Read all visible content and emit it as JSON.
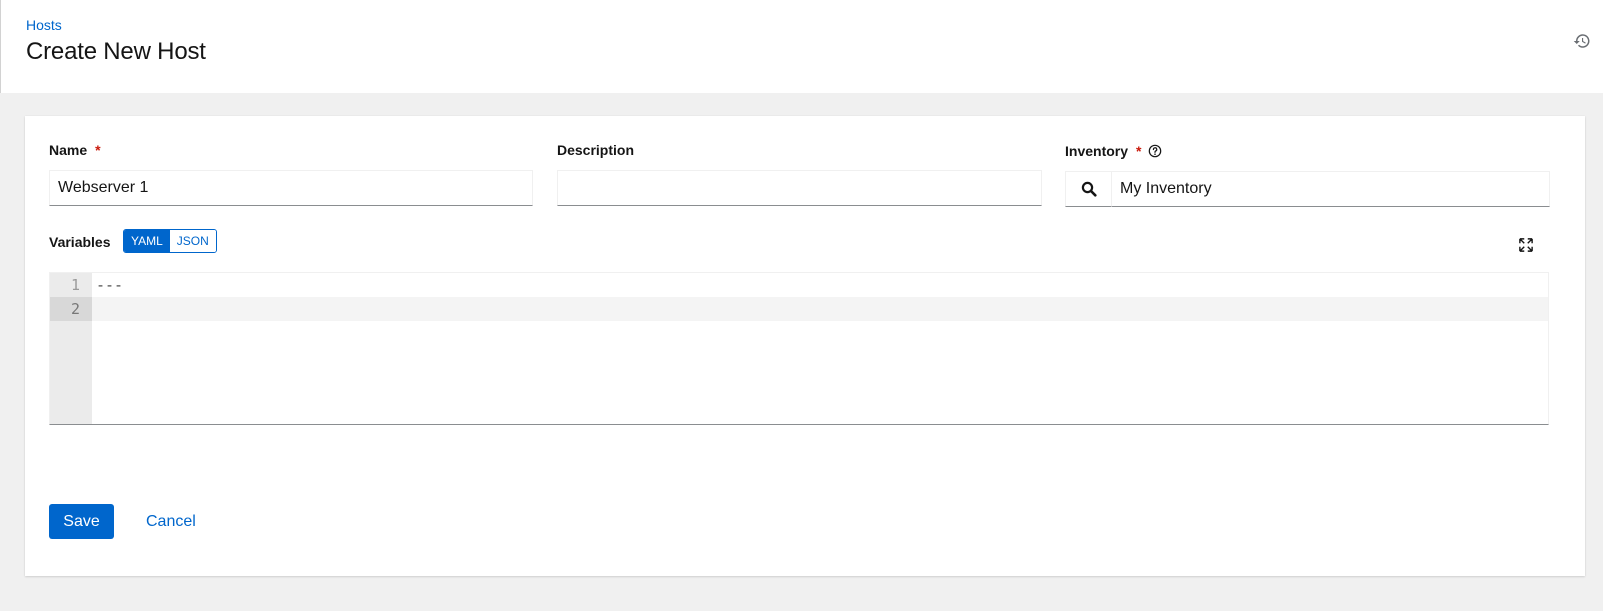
{
  "breadcrumb": {
    "label": "Hosts"
  },
  "page": {
    "title": "Create New Host"
  },
  "form": {
    "name": {
      "label": "Name",
      "required_mark": "*",
      "value": "Webserver 1"
    },
    "description": {
      "label": "Description",
      "value": ""
    },
    "inventory": {
      "label": "Inventory",
      "required_mark": "*",
      "value": "My Inventory"
    },
    "variables": {
      "label": "Variables",
      "modes": [
        "YAML",
        "JSON"
      ],
      "active_mode": "YAML",
      "line_numbers": [
        "1",
        "2"
      ],
      "lines": [
        "---",
        ""
      ]
    }
  },
  "actions": {
    "save_label": "Save",
    "cancel_label": "Cancel"
  },
  "colors": {
    "primary": "#0066cc",
    "required": "#c9190b",
    "background": "#f0f0f0"
  },
  "icons": {
    "history": "history-icon",
    "help": "question-circle-icon",
    "search": "search-icon",
    "expand": "expand-icon"
  }
}
